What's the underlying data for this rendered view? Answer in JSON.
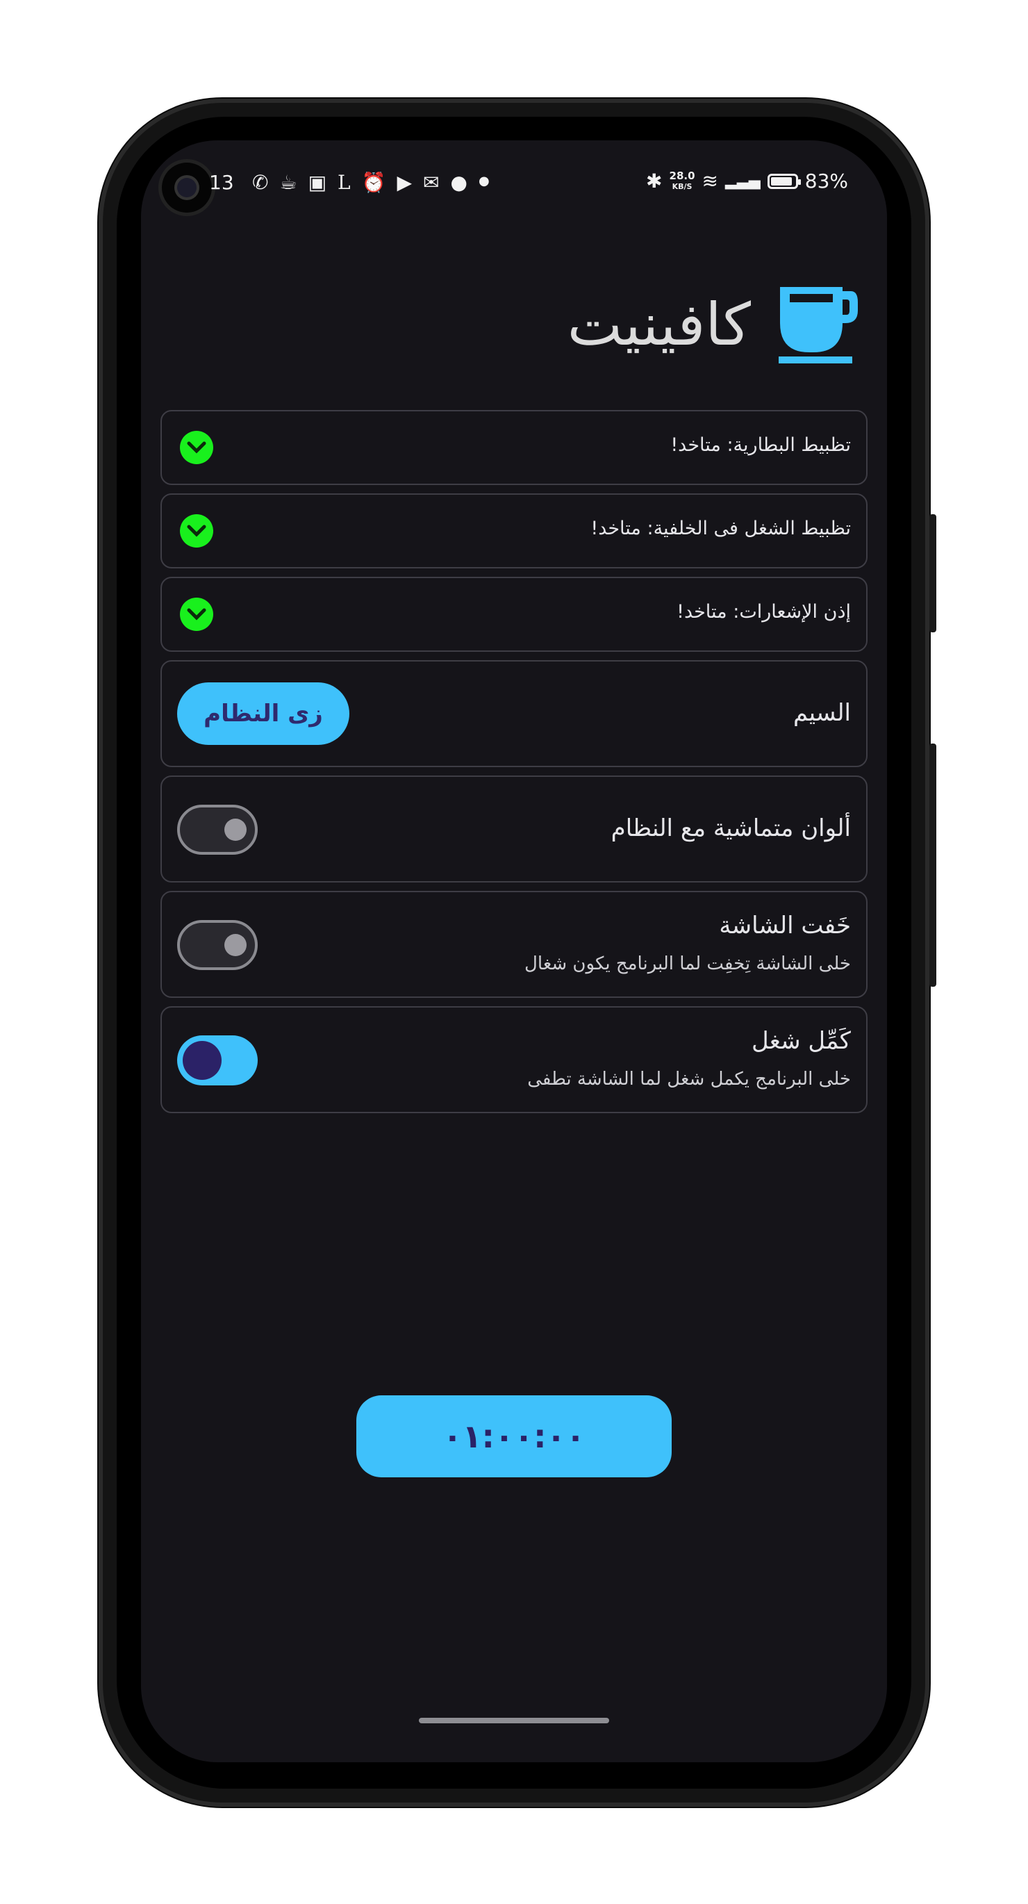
{
  "status_bar": {
    "time": "13",
    "notification_icons": [
      "whatsapp-icon",
      "coffee-icon",
      "bag-icon",
      "l-icon",
      "alarm-icon",
      "youtube-icon",
      "gmail-icon",
      "mickey-icon",
      "dot-icon"
    ],
    "network_speed_value": "28.0",
    "network_speed_unit": "KB/S",
    "battery_percent": "83%"
  },
  "header": {
    "title": "كافينيت",
    "icon": "coffee-cup-icon",
    "accent_color": "#3fc1fb"
  },
  "checks": [
    {
      "label": "تظبيط البطارية: متاخد!",
      "status": "done"
    },
    {
      "label": "تظبيط الشغل فى الخلفية: متاخد!",
      "status": "done"
    },
    {
      "label": "إذن الإشعارات: متاخد!",
      "status": "done"
    }
  ],
  "theme": {
    "label": "السيم",
    "button_label": "زى النظام"
  },
  "settings": [
    {
      "title": "ألوان متماشية مع النظام",
      "subtitle": "",
      "enabled": false
    },
    {
      "title": "خَفت الشاشة",
      "subtitle": "خلى الشاشة تِخفِت لما البرنامج يكون شغال",
      "enabled": false
    },
    {
      "title": "كَمِّل شغل",
      "subtitle": "خلى البرنامج يكمل شغل لما الشاشة تطفى",
      "enabled": true
    }
  ],
  "timer": {
    "label": "٠١:٠٠:٠٠"
  }
}
